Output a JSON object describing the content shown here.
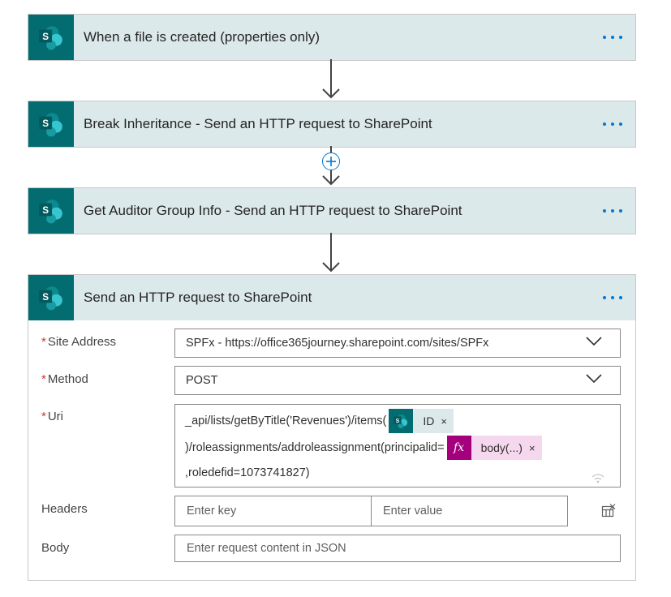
{
  "steps": [
    {
      "title": "When a file is created (properties only)"
    },
    {
      "title": "Break Inheritance - Send an HTTP request to SharePoint"
    },
    {
      "title": "Get Auditor Group Info - Send an HTTP request to SharePoint"
    },
    {
      "title": "Send an HTTP request to SharePoint"
    }
  ],
  "icons": {
    "connector": "sharepoint-icon",
    "more": "ellipsis-icon",
    "add": "plus-circle-icon",
    "arrow": "arrow-down-icon",
    "chevron": "chevron-down-icon",
    "expression": "fx-icon",
    "remove": "close-icon",
    "signal": "wireless-icon",
    "delete_row": "table-delete-icon"
  },
  "form": {
    "site_address": {
      "label": "Site Address",
      "value": "SPFx - https://office365journey.sharepoint.com/sites/SPFx"
    },
    "method": {
      "label": "Method",
      "value": "POST"
    },
    "uri": {
      "label": "Uri",
      "line1_text": "_api/lists/getByTitle('Revenues')/items(",
      "token1_label": "ID",
      "line2_text": ")/roleassignments/addroleassignment(principalid=",
      "token2_icon_label": "fx",
      "token2_label": "body(...)",
      "line3_text": ",roledefid=1073741827)",
      "remove_glyph": "×"
    },
    "headers": {
      "label": "Headers",
      "key_placeholder": "Enter key",
      "value_placeholder": "Enter value"
    },
    "body": {
      "label": "Body",
      "placeholder": "Enter request content in JSON"
    },
    "required_mark": "*"
  },
  "colors": {
    "header_bg": "#dce9ea",
    "sharepoint_teal": "#036c70",
    "accent_blue": "#0078d4",
    "required_red": "#d13438",
    "expression_purple": "#a4007e",
    "expression_token_bg": "#f5d7ee"
  }
}
